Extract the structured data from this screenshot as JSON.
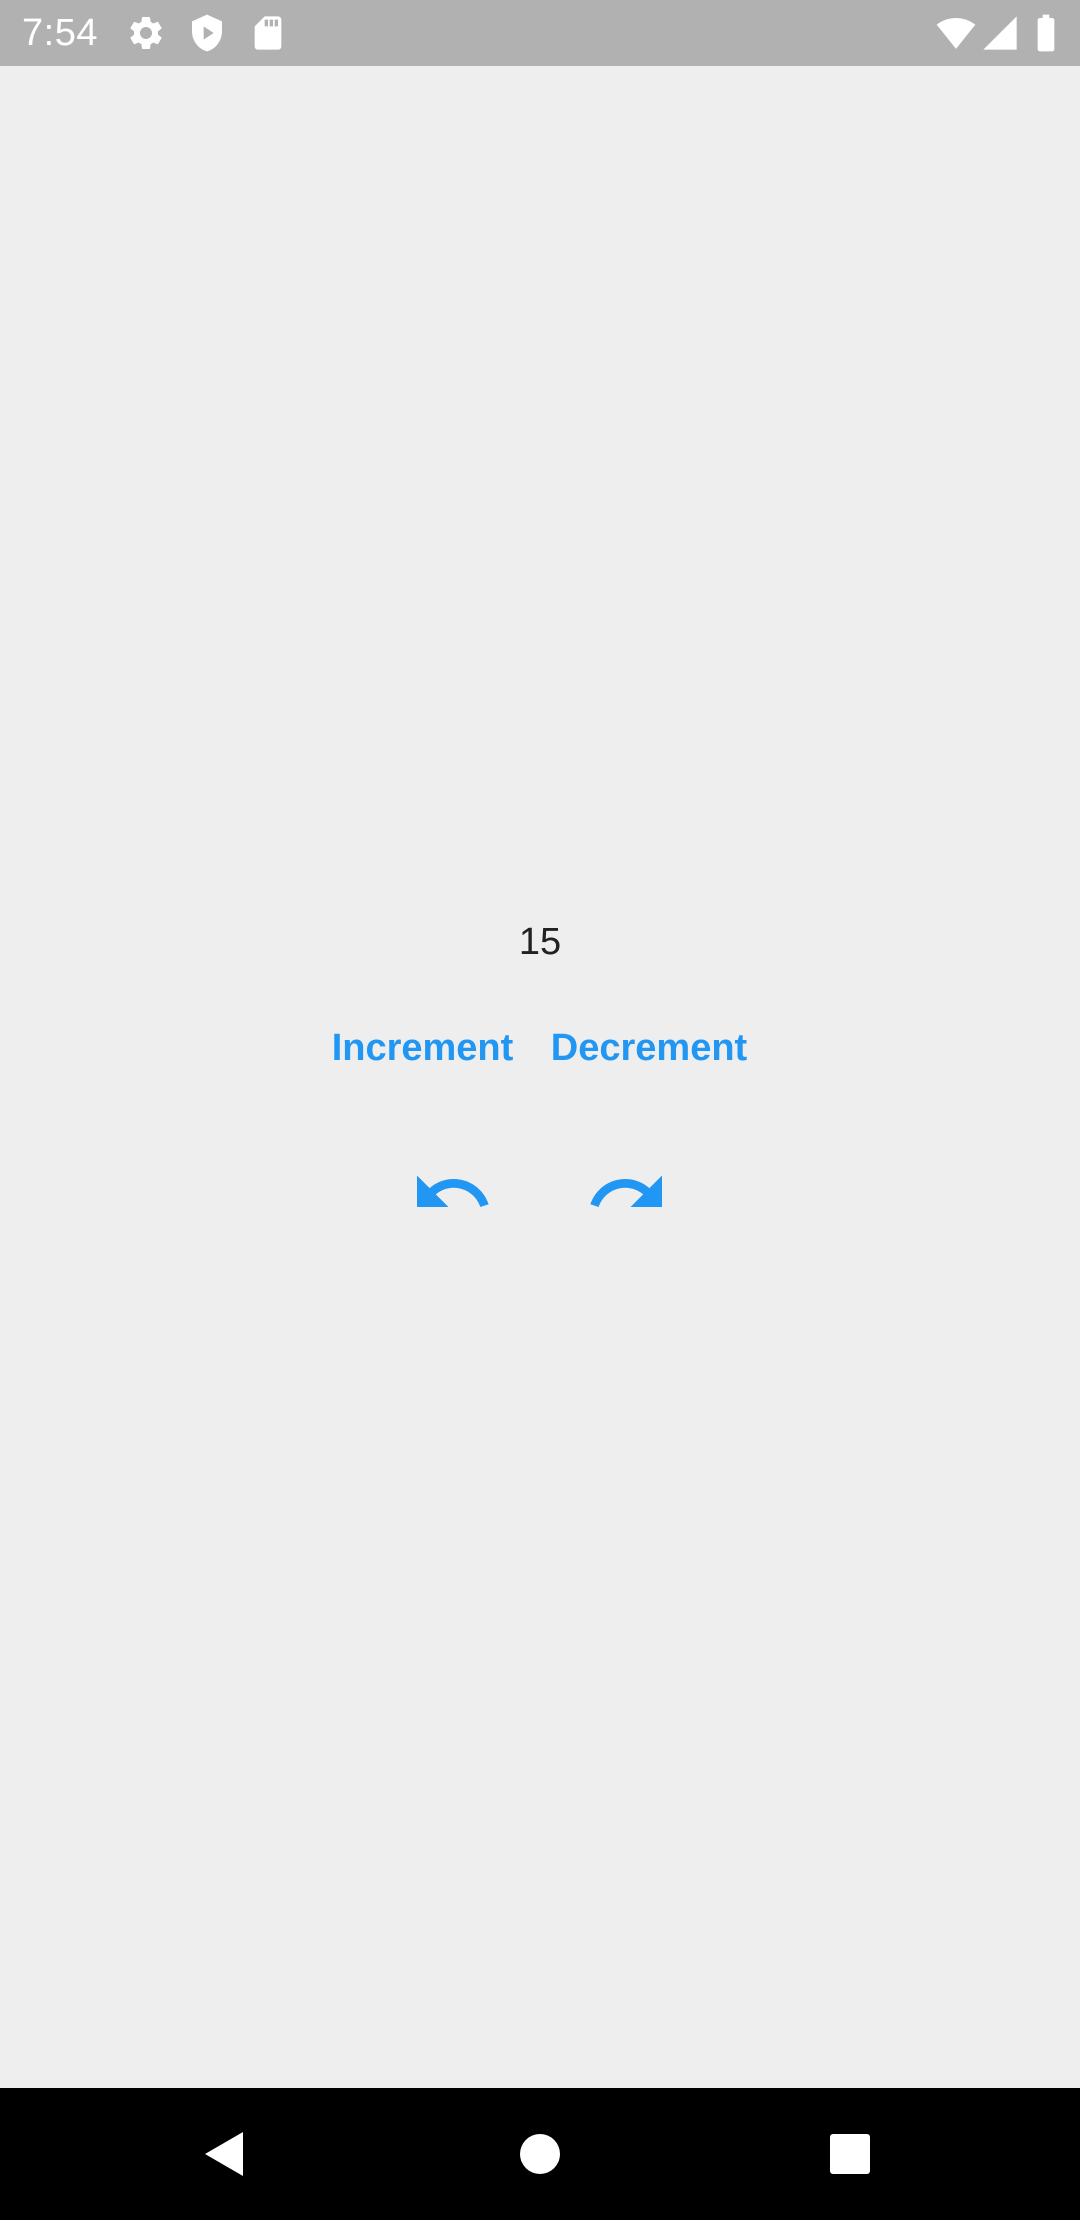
{
  "status_bar": {
    "time": "7:54",
    "icons": [
      "gear-icon",
      "shield-play-icon",
      "sd-card-icon",
      "wifi-icon",
      "cell-signal-icon",
      "battery-icon"
    ]
  },
  "counter": {
    "value": "15"
  },
  "actions": {
    "increment_label": "Increment",
    "decrement_label": "Decrement",
    "undo_icon": "undo-icon",
    "redo_icon": "redo-icon"
  },
  "navigation_bar": {
    "buttons": [
      "back-icon",
      "home-icon",
      "recents-icon"
    ]
  },
  "colors": {
    "accent": "#2196f3",
    "background": "#eeeeee",
    "status_bar": "#b1b1b1",
    "nav_bar": "#000000",
    "text": "#212121"
  }
}
